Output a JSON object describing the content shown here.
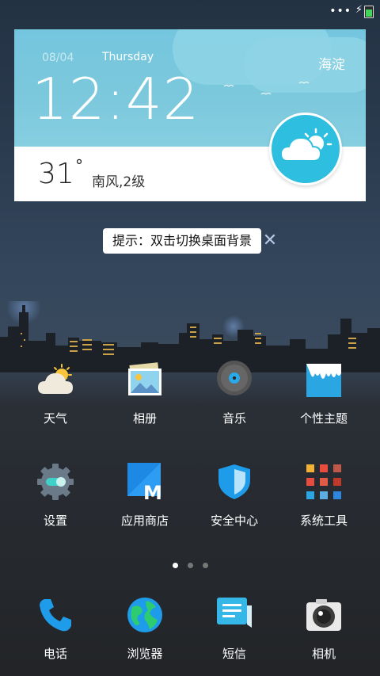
{
  "status_bar": {
    "dots": "•••",
    "charging_icon": "bolt-icon",
    "battery_level": 0.75
  },
  "weather_widget": {
    "date": "08/04",
    "weekday": "Thursday",
    "location": "海淀",
    "time": "12:42",
    "temperature": "31",
    "degree": "°",
    "wind": "南风,2级",
    "condition_icon": "partly-cloudy-icon"
  },
  "hint": {
    "text": "提示：双击切换桌面背景",
    "close": "✕"
  },
  "apps": [
    {
      "label": "天气",
      "icon": "weather-icon"
    },
    {
      "label": "相册",
      "icon": "gallery-icon"
    },
    {
      "label": "音乐",
      "icon": "music-icon"
    },
    {
      "label": "个性主题",
      "icon": "theme-icon"
    },
    {
      "label": "设置",
      "icon": "settings-icon"
    },
    {
      "label": "应用商店",
      "icon": "app-store-icon"
    },
    {
      "label": "安全中心",
      "icon": "security-icon"
    },
    {
      "label": "系统工具",
      "icon": "system-tools-icon"
    }
  ],
  "page_indicator": {
    "count": 3,
    "active": 0
  },
  "dock": [
    {
      "label": "电话",
      "icon": "phone-icon"
    },
    {
      "label": "浏览器",
      "icon": "browser-icon"
    },
    {
      "label": "短信",
      "icon": "messages-icon"
    },
    {
      "label": "相机",
      "icon": "camera-icon"
    }
  ],
  "colors": {
    "widget_sky": "#74c6de",
    "weather_badge": "#2ebfe0",
    "accent_blue": "#1e9be9"
  }
}
